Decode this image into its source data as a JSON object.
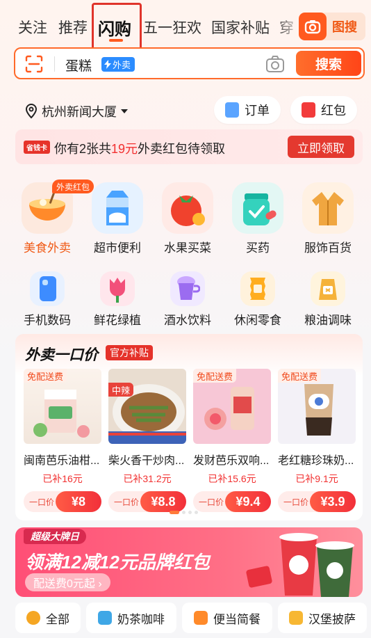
{
  "top_tabs": [
    {
      "label": "关注"
    },
    {
      "label": "推荐"
    },
    {
      "label": "闪购",
      "active": true
    },
    {
      "label": "五一狂欢"
    },
    {
      "label": "国家补贴"
    },
    {
      "label": "穿"
    }
  ],
  "image_search": {
    "label": "图搜",
    "icon": "camera-icon"
  },
  "search": {
    "query": "蛋糕",
    "badge": "外卖",
    "button": "搜索",
    "scan_icon": "scan-icon",
    "camera_icon": "camera-icon"
  },
  "location": {
    "label": "杭州新闻大厦",
    "icon": "location-pin-icon"
  },
  "quick_actions": [
    {
      "label": "订单",
      "icon": "order-icon"
    },
    {
      "label": "红包",
      "icon": "red-packet-icon"
    }
  ],
  "red_packet_banner": {
    "tag": "省钱卡",
    "text_prefix": "你有2张共",
    "amount": "19元",
    "text_suffix": "外卖红包待领取",
    "button": "立即领取"
  },
  "categories_row1": [
    {
      "label": "美食外卖",
      "corner": "外卖红包",
      "highlight": true
    },
    {
      "label": "超市便利"
    },
    {
      "label": "水果买菜"
    },
    {
      "label": "买药"
    },
    {
      "label": "服饰百货"
    }
  ],
  "categories_row2": [
    {
      "label": "手机数码"
    },
    {
      "label": "鲜花绿植"
    },
    {
      "label": "酒水饮料"
    },
    {
      "label": "休闲零食"
    },
    {
      "label": "粮油调味"
    }
  ],
  "deal_section": {
    "title": "外卖一口价",
    "badge": "官方补贴",
    "price_prefix": "一口价",
    "items": [
      {
        "name": "闽南芭乐油柑...",
        "subsidy": "已补16元",
        "price": "¥8",
        "free_delivery": "免配送费"
      },
      {
        "name": "柴火香干炒肉...",
        "subsidy": "已补31.2元",
        "price": "¥8.8",
        "free_delivery": ""
      },
      {
        "name": "发财芭乐双响...",
        "subsidy": "已补15.6元",
        "price": "¥9.4",
        "free_delivery": "免配送费"
      },
      {
        "name": "老红糖珍珠奶...",
        "subsidy": "已补9.1元",
        "price": "¥3.9",
        "free_delivery": "免配送费"
      }
    ]
  },
  "promo_banner": {
    "kicker": "超级大牌日",
    "headline": "领满12减12元品牌红包",
    "subline": "配送费0元起 ›"
  },
  "filter_pills": [
    {
      "label": "全部"
    },
    {
      "label": "奶茶咖啡"
    },
    {
      "label": "便当简餐"
    },
    {
      "label": "汉堡披萨"
    }
  ],
  "colors": {
    "brand": "#ff5a1f",
    "price_red": "#f23030",
    "highlight_box": "#e0342b"
  }
}
